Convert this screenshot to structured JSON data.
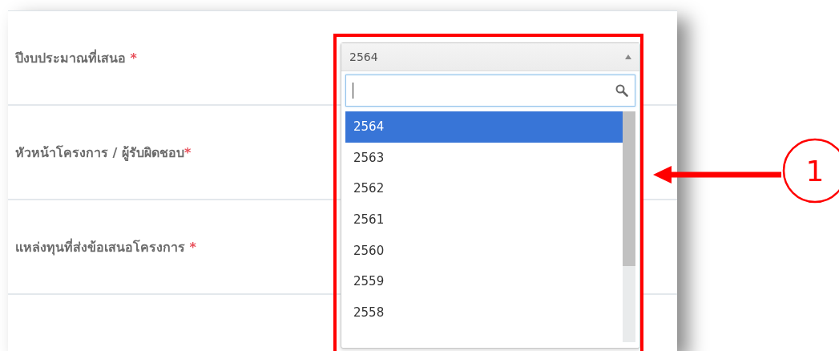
{
  "form": {
    "fields": [
      {
        "label": "ปีงบประมาณที่เสนอ ",
        "mark": "*"
      },
      {
        "label": "หัวหน้าโครงการ / ผู้รับผิดชอบ",
        "mark": "*"
      },
      {
        "label": "แหล่งทุนที่ส่งข้อเสนอโครงการ ",
        "mark": "*"
      }
    ]
  },
  "select": {
    "value": "2564",
    "expanded": true,
    "options": [
      {
        "label": "2564",
        "selected": true
      },
      {
        "label": "2563",
        "selected": false
      },
      {
        "label": "2562",
        "selected": false
      },
      {
        "label": "2561",
        "selected": false
      },
      {
        "label": "2560",
        "selected": false
      },
      {
        "label": "2559",
        "selected": false
      },
      {
        "label": "2558",
        "selected": false
      }
    ]
  },
  "annotation": {
    "number": "1"
  }
}
